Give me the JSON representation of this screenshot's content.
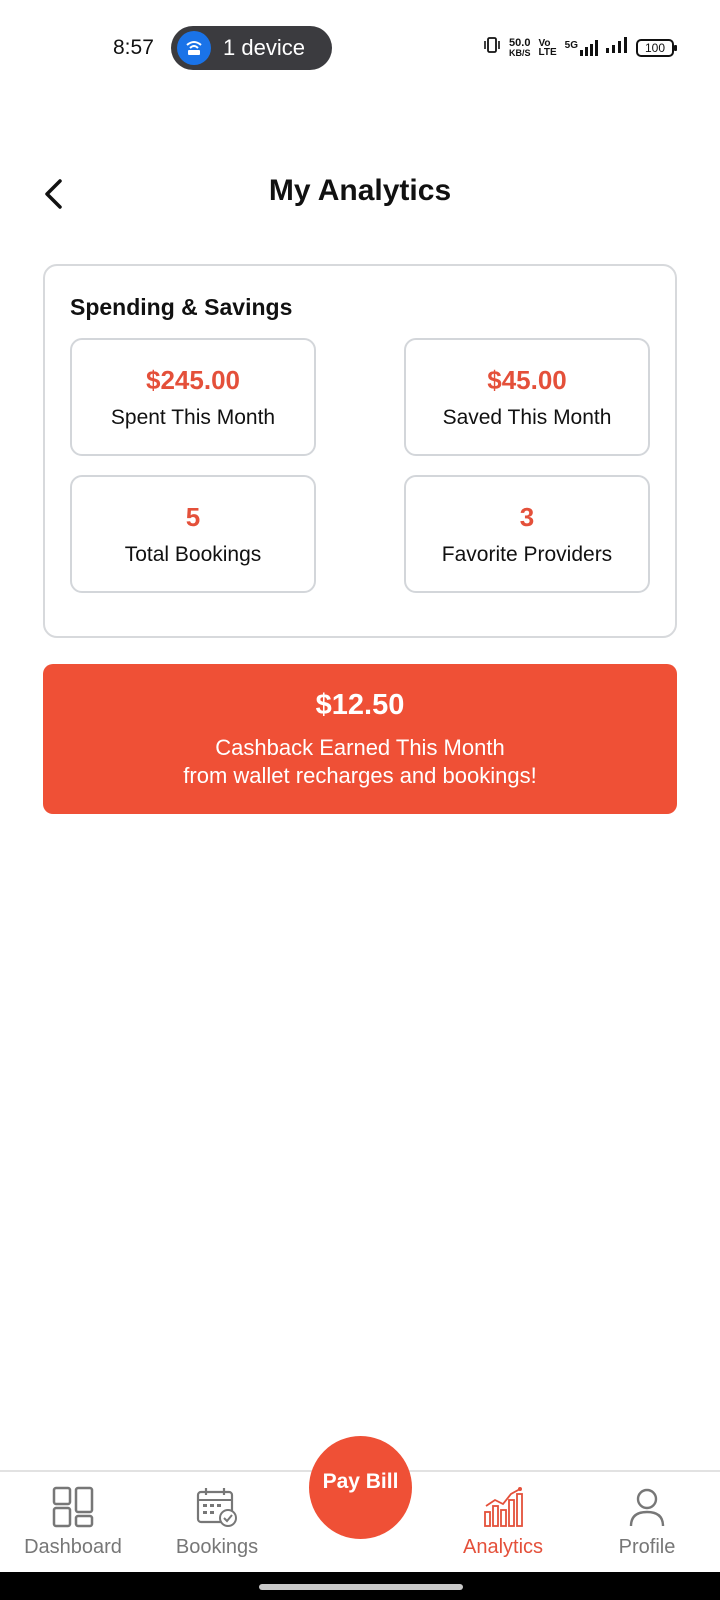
{
  "status_bar": {
    "time": "8:57",
    "hotspot_label": "1 device",
    "net_speed_value": "50.0",
    "net_speed_unit": "KB/S",
    "volte_top": "Vo",
    "volte_bottom": "LTE",
    "network_type": "5G",
    "battery": "100"
  },
  "header": {
    "title": "My Analytics"
  },
  "spending_card": {
    "title": "Spending & Savings",
    "stats": [
      {
        "value": "$245.00",
        "label": "Spent This Month"
      },
      {
        "value": "$45.00",
        "label": "Saved This Month"
      },
      {
        "value": "5",
        "label": "Total Bookings"
      },
      {
        "value": "3",
        "label": "Favorite Providers"
      }
    ]
  },
  "cashback": {
    "amount": "$12.50",
    "line1": "Cashback Earned This Month",
    "line2": "from wallet recharges and bookings!"
  },
  "bottom_nav": {
    "items": [
      {
        "label": "Dashboard",
        "icon": "dashboard-grid-icon"
      },
      {
        "label": "Bookings",
        "icon": "calendar-check-icon"
      },
      {
        "label": "Analytics",
        "icon": "bar-chart-icon",
        "active": true
      },
      {
        "label": "Profile",
        "icon": "user-icon"
      }
    ],
    "fab_label": "Pay Bill"
  },
  "colors": {
    "accent": "#ef5036",
    "accent_text": "#e4503a",
    "inactive_nav": "#777777",
    "border": "#d7d9dc"
  }
}
